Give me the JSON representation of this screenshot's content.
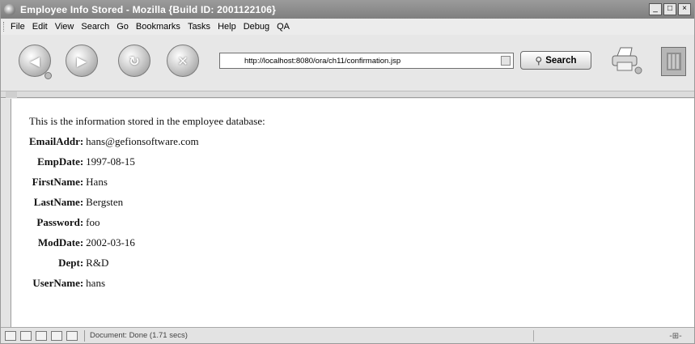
{
  "window": {
    "title": "Employee Info Stored - Mozilla {Build ID: 2001122106}",
    "controls": [
      "_",
      "□",
      "×"
    ]
  },
  "menu": [
    {
      "label": "File"
    },
    {
      "label": "Edit"
    },
    {
      "label": "View"
    },
    {
      "label": "Search"
    },
    {
      "label": "Go"
    },
    {
      "label": "Bookmarks"
    },
    {
      "label": "Tasks"
    },
    {
      "label": "Help"
    },
    {
      "label": "Debug"
    },
    {
      "label": "QA"
    }
  ],
  "toolbar": {
    "url": "http://localhost:8080/ora/ch11/confirmation.jsp",
    "search_label": "Search"
  },
  "content": {
    "intro": "This is the information stored in the employee database:",
    "fields": [
      {
        "label": "EmailAddr:",
        "value": "hans@gefionsoftware.com"
      },
      {
        "label": "EmpDate:",
        "value": "1997-08-15"
      },
      {
        "label": "FirstName:",
        "value": "Hans"
      },
      {
        "label": "LastName:",
        "value": "Bergsten"
      },
      {
        "label": "Password:",
        "value": "foo"
      },
      {
        "label": "ModDate:",
        "value": "2002-03-16"
      },
      {
        "label": "Dept:",
        "value": "R&D"
      },
      {
        "label": "UserName:",
        "value": "hans"
      }
    ]
  },
  "status": {
    "text": "Document: Done (1.71 secs)"
  },
  "icons": {
    "back": "back-arrow-icon",
    "forward": "forward-arrow-icon",
    "reload": "reload-icon",
    "stop": "stop-icon",
    "search": "magnifier-icon",
    "print": "printer-icon",
    "throbber": "throbber-icon"
  }
}
